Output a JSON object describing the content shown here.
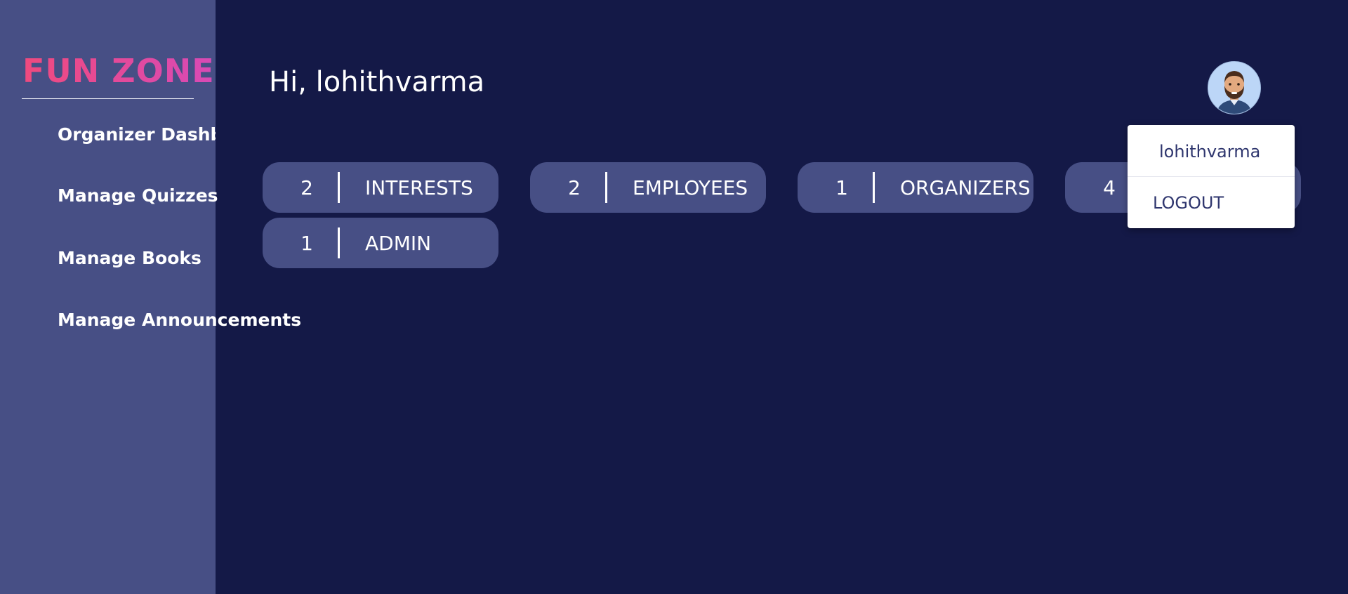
{
  "sidebar": {
    "logo": "FUN ZONE",
    "items": [
      {
        "label": "Organizer Dashboard"
      },
      {
        "label": "Manage Quizzes"
      },
      {
        "label": "Manage Books"
      },
      {
        "label": "Manage Announcements"
      }
    ]
  },
  "header": {
    "greeting": "Hi, lohithvarma",
    "avatar_icon": "bearded-man-avatar-icon"
  },
  "stats": [
    {
      "count": "2",
      "label": "INTERESTS"
    },
    {
      "count": "2",
      "label": "EMPLOYEES"
    },
    {
      "count": "1",
      "label": "ORGANIZERS"
    },
    {
      "count": "4",
      "label": ""
    },
    {
      "count": "1",
      "label": "ADMIN"
    }
  ],
  "dropdown": {
    "username": "lohithvarma",
    "logout_label": "LOGOUT"
  },
  "colors": {
    "background": "#141947",
    "sidebar": "#474f85",
    "pill": "#474f85",
    "logo_start": "#ef4a7e",
    "logo_end": "#d84ab6",
    "dropdown_text": "#2f366e"
  }
}
